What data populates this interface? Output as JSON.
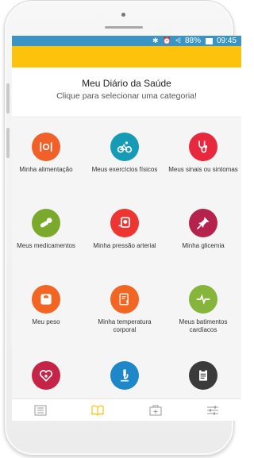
{
  "status_bar": {
    "battery": "88%",
    "time": "09:45",
    "icons": [
      "bluetooth-icon",
      "alarm-icon",
      "wifi-icon",
      "signal-icon",
      "battery-icon"
    ]
  },
  "header": {
    "title": "Meu Diário da Saúde",
    "subtitle": "Clique para selecionar uma categoria!"
  },
  "categories": [
    {
      "label": "Minha alimentação",
      "icon": "food-icon",
      "color": "#f2602a"
    },
    {
      "label": "Meus exercícios físicos",
      "icon": "bicycle-icon",
      "color": "#169bb6"
    },
    {
      "label": "Meus sinais ou sintomas",
      "icon": "stethoscope-icon",
      "color": "#e8283c"
    },
    {
      "label": "Meus medicamentos",
      "icon": "pills-icon",
      "color": "#7ba92b"
    },
    {
      "label": "Minha pressão arterial",
      "icon": "blood-pressure-icon",
      "color": "#ee3531"
    },
    {
      "label": "Minha glicemia",
      "icon": "pin-icon",
      "color": "#b5234d"
    },
    {
      "label": "Meu peso",
      "icon": "scale-icon",
      "color": "#f26522"
    },
    {
      "label": "Minha temperatura corporal",
      "icon": "thermometer-icon",
      "color": "#f26522"
    },
    {
      "label": "Meus batimentos cardíacos",
      "icon": "heartbeat-icon",
      "color": "#86b53c"
    },
    {
      "label": "",
      "icon": "heart-stethoscope-icon",
      "color": "#c52348"
    },
    {
      "label": "",
      "icon": "microscope-icon",
      "color": "#1e87c9"
    },
    {
      "label": "",
      "icon": "clipboard-icon",
      "color": "#3b3b3b"
    }
  ],
  "tabbar": {
    "tabs": [
      {
        "icon": "list-icon",
        "active": false
      },
      {
        "icon": "book-icon",
        "active": true
      },
      {
        "icon": "first-aid-icon",
        "active": false
      },
      {
        "icon": "sliders-icon",
        "active": false
      }
    ],
    "active_color": "#fdc20c",
    "inactive_color": "#9a9a9a"
  }
}
